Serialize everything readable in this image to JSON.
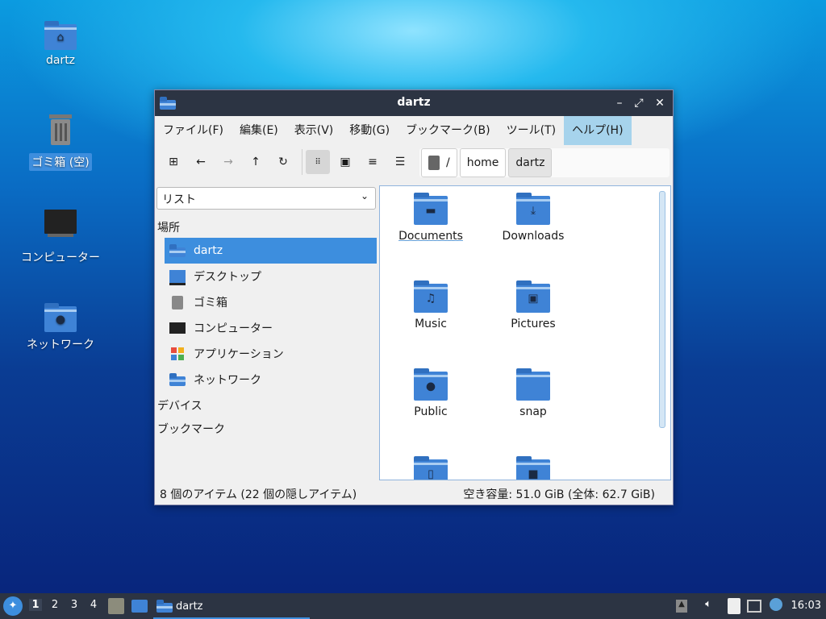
{
  "desktop": {
    "icons": [
      {
        "label": "dartz"
      },
      {
        "label": "ゴミ箱 (空)"
      },
      {
        "label": "コンピューター"
      },
      {
        "label": "ネットワーク"
      }
    ]
  },
  "window": {
    "title": "dartz",
    "menu": [
      "ファイル(F)",
      "編集(E)",
      "表示(V)",
      "移動(G)",
      "ブックマーク(B)",
      "ツール(T)",
      "ヘルプ(H)"
    ],
    "path": [
      "/",
      "home",
      "dartz"
    ],
    "side": {
      "view_mode": "リスト",
      "section_places": "場所",
      "places": [
        "dartz",
        "デスクトップ",
        "ゴミ箱",
        "コンピューター",
        "アプリケーション",
        "ネットワーク"
      ],
      "section_devices": "デバイス",
      "section_bookmarks": "ブックマーク"
    },
    "files": [
      "Documents",
      "Downloads",
      "Music",
      "Pictures",
      "Public",
      "snap"
    ],
    "status": {
      "left": "8 個のアイテム (22 個の隠しアイテム)",
      "right": "空き容量: 51.0 GiB (全体: 62.7 GiB)"
    }
  },
  "taskbar": {
    "workspaces": [
      "1",
      "2",
      "3",
      "4"
    ],
    "task": "dartz",
    "clock": "16:03"
  },
  "colors": {
    "accent": "#3d8ede",
    "folder": "#3f83d6",
    "panel": "#2c3443"
  }
}
